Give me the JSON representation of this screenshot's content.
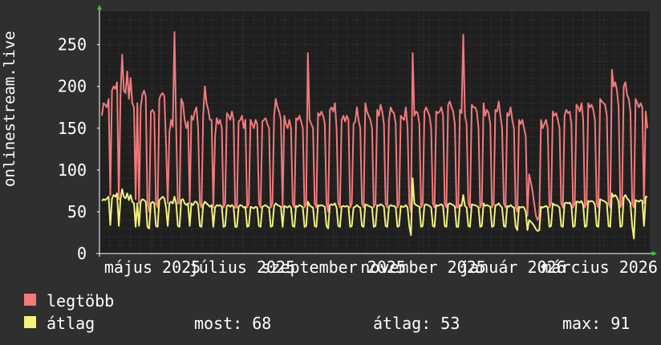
{
  "chart_data": {
    "type": "line",
    "ylabel": "onlinestream.live",
    "ylim": [
      0,
      290
    ],
    "yticks": [
      "0",
      "50",
      "100",
      "150",
      "200",
      "250"
    ],
    "ytick_values": [
      0,
      50,
      100,
      150,
      200,
      250
    ],
    "xtick_labels": [
      "május 2025",
      "július 2025",
      "szeptember 2025",
      "november 2025",
      "január 2026",
      "március 2026"
    ],
    "grid": true,
    "x_start": "2025-03-26",
    "x_end": "2026-04-04",
    "series": [
      {
        "name": "legtöbb",
        "color": "#f37a7a",
        "values": [
          165,
          180,
          178,
          175,
          185,
          70,
          195,
          200,
          197,
          205,
          65,
          188,
          238,
          195,
          192,
          218,
          185,
          210,
          180,
          175,
          65,
          180,
          60,
          175,
          190,
          195,
          188,
          60,
          50,
          170,
          172,
          168,
          60,
          55,
          185,
          190,
          192,
          188,
          130,
          60,
          145,
          160,
          152,
          265,
          150,
          60,
          60,
          185,
          180,
          160,
          150,
          158,
          60,
          165,
          160,
          170,
          175,
          150,
          60,
          55,
          165,
          200,
          180,
          172,
          160,
          160,
          55,
          140,
          162,
          155,
          160,
          150,
          55,
          60,
          168,
          165,
          160,
          170,
          160,
          55,
          55,
          158,
          160,
          165,
          150,
          160,
          55,
          60,
          160,
          155,
          150,
          160,
          155,
          60,
          55,
          158,
          160,
          162,
          155,
          150,
          55,
          60,
          165,
          185,
          175,
          170,
          160,
          55,
          165,
          155,
          150,
          160,
          150,
          60,
          55,
          162,
          160,
          165,
          158,
          150,
          55,
          60,
          240,
          160,
          155,
          150,
          60,
          55,
          168,
          165,
          170,
          165,
          155,
          60,
          50,
          172,
          175,
          170,
          180,
          150,
          60,
          55,
          160,
          165,
          158,
          165,
          160,
          55,
          60,
          155,
          158,
          175,
          160,
          150,
          60,
          55,
          180,
          170,
          165,
          160,
          150,
          55,
          60,
          172,
          165,
          178,
          170,
          155,
          60,
          55,
          160,
          175,
          170,
          168,
          155,
          55,
          60,
          165,
          162,
          160,
          175,
          150,
          60,
          50,
          240,
          165,
          170,
          168,
          155,
          55,
          60,
          170,
          175,
          170,
          165,
          150,
          60,
          55,
          170,
          168,
          170,
          175,
          165,
          60,
          55,
          178,
          182,
          175,
          170,
          155,
          55,
          55,
          172,
          168,
          262,
          165,
          155,
          60,
          55,
          178,
          175,
          175,
          170,
          150,
          55,
          60,
          180,
          165,
          172,
          168,
          155,
          55,
          60,
          172,
          170,
          182,
          165,
          150,
          60,
          55,
          168,
          165,
          175,
          160,
          150,
          55,
          50,
          160,
          155,
          160,
          150,
          140,
          45,
          95,
          85,
          75,
          60,
          45,
          40,
          45,
          160,
          150,
          155,
          160,
          150,
          55,
          60,
          170,
          165,
          168,
          160,
          150,
          60,
          55,
          165,
          172,
          168,
          170,
          155,
          55,
          60,
          178,
          175,
          170,
          180,
          160,
          55,
          60,
          180,
          175,
          178,
          172,
          160,
          60,
          55,
          185,
          182,
          180,
          178,
          165,
          60,
          55,
          220,
          200,
          205,
          195,
          175,
          55,
          60,
          200,
          205,
          190,
          185,
          170,
          60,
          55,
          185,
          180,
          175,
          180,
          175,
          60,
          170,
          150
        ]
      },
      {
        "name": "átlag",
        "color": "#f3f27a",
        "values": [
          63,
          65,
          64,
          66,
          68,
          34,
          66,
          70,
          68,
          72,
          33,
          65,
          77,
          68,
          66,
          72,
          64,
          70,
          62,
          60,
          32,
          60,
          33,
          62,
          65,
          64,
          62,
          32,
          30,
          60,
          62,
          60,
          33,
          32,
          64,
          66,
          68,
          66,
          55,
          33,
          60,
          62,
          60,
          68,
          60,
          33,
          32,
          64,
          65,
          60,
          58,
          60,
          33,
          60,
          58,
          62,
          62,
          58,
          33,
          32,
          58,
          62,
          60,
          58,
          56,
          58,
          32,
          55,
          58,
          57,
          58,
          56,
          32,
          33,
          57,
          58,
          56,
          58,
          56,
          32,
          32,
          56,
          58,
          57,
          55,
          56,
          32,
          33,
          56,
          55,
          54,
          56,
          55,
          33,
          32,
          56,
          57,
          58,
          56,
          55,
          32,
          33,
          57,
          60,
          58,
          57,
          56,
          32,
          57,
          56,
          55,
          57,
          55,
          33,
          32,
          57,
          56,
          58,
          57,
          55,
          32,
          33,
          62,
          58,
          56,
          55,
          33,
          32,
          58,
          57,
          58,
          57,
          56,
          33,
          30,
          58,
          59,
          58,
          60,
          55,
          33,
          32,
          56,
          57,
          56,
          57,
          56,
          32,
          33,
          55,
          56,
          58,
          56,
          55,
          33,
          32,
          59,
          58,
          57,
          56,
          55,
          32,
          33,
          58,
          57,
          59,
          58,
          56,
          33,
          32,
          56,
          58,
          57,
          57,
          55,
          32,
          33,
          57,
          56,
          56,
          58,
          55,
          33,
          22,
          90,
          60,
          58,
          57,
          56,
          32,
          33,
          58,
          59,
          58,
          57,
          55,
          33,
          32,
          58,
          57,
          58,
          59,
          57,
          33,
          32,
          59,
          60,
          59,
          58,
          56,
          32,
          32,
          58,
          57,
          70,
          57,
          55,
          33,
          32,
          59,
          58,
          58,
          57,
          55,
          32,
          33,
          60,
          57,
          58,
          57,
          56,
          32,
          33,
          58,
          58,
          60,
          57,
          55,
          33,
          32,
          57,
          56,
          58,
          56,
          55,
          32,
          28,
          56,
          55,
          56,
          55,
          50,
          28,
          40,
          38,
          36,
          33,
          29,
          27,
          28,
          56,
          55,
          56,
          57,
          55,
          32,
          33,
          60,
          58,
          58,
          57,
          55,
          33,
          32,
          60,
          61,
          60,
          61,
          57,
          32,
          33,
          62,
          62,
          61,
          63,
          58,
          32,
          33,
          63,
          62,
          63,
          62,
          58,
          33,
          32,
          65,
          64,
          63,
          62,
          60,
          33,
          32,
          72,
          68,
          70,
          67,
          62,
          32,
          33,
          67,
          70,
          66,
          64,
          60,
          33,
          18,
          64,
          63,
          62,
          64,
          63,
          33,
          68,
          68
        ]
      }
    ]
  },
  "legend": [
    {
      "label": "legtöbb",
      "color": "#f37a7a"
    },
    {
      "label": "átlag",
      "color": "#f3f27a"
    }
  ],
  "stats": {
    "now": "most: 68",
    "avg": "átlag: 53",
    "max": "max: 91"
  }
}
